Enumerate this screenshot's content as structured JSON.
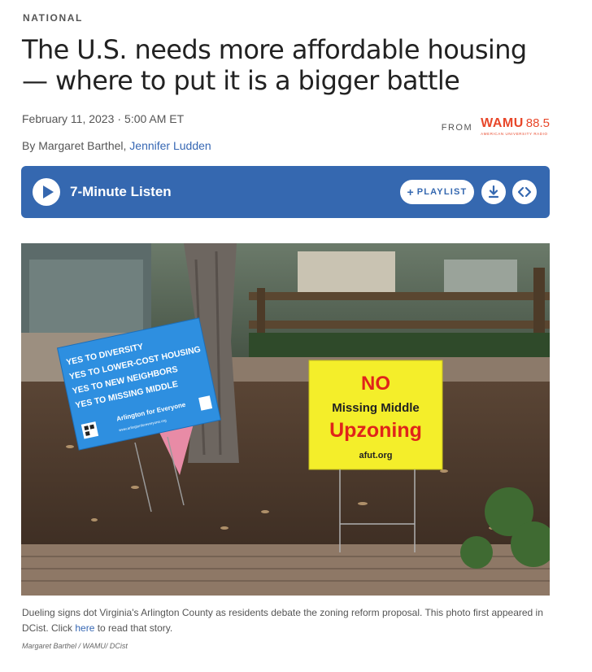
{
  "section": "NATIONAL",
  "headline": "The U.S. needs more affordable housing — where to put it is a bigger battle",
  "dateline": {
    "date": "February 11, 2023",
    "separator": "·",
    "time": "5:00 AM ET"
  },
  "byline": {
    "prefix": "By Margaret Barthel, ",
    "linked_author": "Jennifer Ludden"
  },
  "source": {
    "from_label": "FROM",
    "station_name": "WAMU",
    "frequency": "88.5",
    "tagline": "AMERICAN UNIVERSITY RADIO"
  },
  "audio": {
    "listen_label": "7-Minute Listen",
    "playlist_plus": "+",
    "playlist_label": "PLAYLIST"
  },
  "photo": {
    "left_sign_lines": [
      "YES TO DIVERSITY",
      "YES TO LOWER-COST HOUSING",
      "YES TO NEW NEIGHBORS",
      "YES TO MISSING MIDDLE"
    ],
    "left_sign_brand": "Arlington for Everyone",
    "left_sign_url": "www.arlingtonforeveryone.org",
    "right_sign_lines": [
      "NO",
      "Missing Middle",
      "Upzoning",
      "afut.org"
    ]
  },
  "caption": {
    "before_link": "Dueling signs dot Virginia's Arlington County as residents debate the zoning reform proposal. This photo first appeared in DCist. Click ",
    "link_text": "here",
    "after_link": " to read that story."
  },
  "credit": "Margaret Barthel / WAMU/ DCist",
  "colors": {
    "accent_blue": "#3568b0",
    "link_blue": "#3667b3",
    "wamu_red": "#e8472a",
    "sign_yellow": "#f4ee2a",
    "sign_red": "#e0241a",
    "sign_blue": "#2e8fe0"
  },
  "icons": [
    "play-icon",
    "plus-icon",
    "download-icon",
    "embed-icon"
  ]
}
